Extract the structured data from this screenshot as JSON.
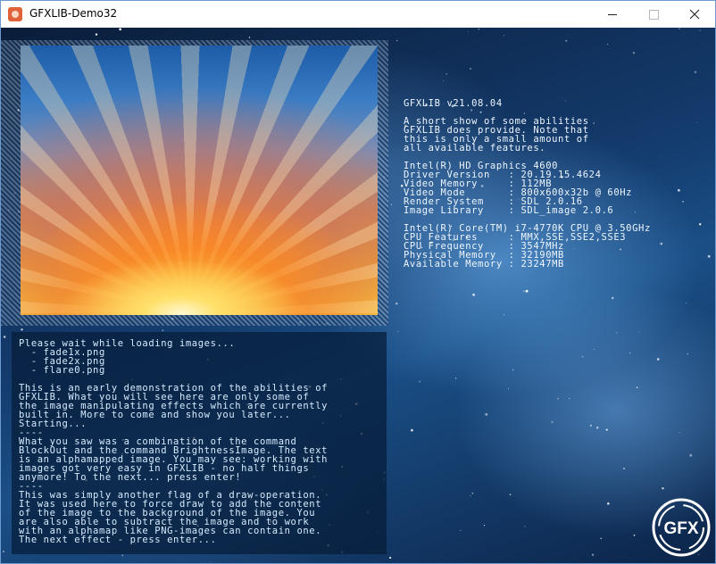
{
  "window": {
    "title": "GFXLIB-Demo32",
    "controls": {
      "minimize": "minimize",
      "maximize": "maximize",
      "close": "close"
    }
  },
  "system_info": {
    "lines": [
      "GFXLIB v21.08.04",
      "",
      "A short show of some abilities",
      "GFXLIB does provide. Note that",
      "this is only a small amount of",
      "all available features.",
      "",
      "Intel(R) HD Graphics 4600",
      "Driver Version   : 20.19.15.4624",
      "Video Memory     : 112MB",
      "Video Mode       : 800x600x32b @ 60Hz",
      "Render System    : SDL 2.0.16",
      "Image Library    : SDL_image 2.0.6",
      "",
      "Intel(R) Core(TM) i7-4770K CPU @ 3.50GHz",
      "CPU Features     : MMX,SSE,SSE2,SSE3",
      "CPU Frequency    : 3547MHz",
      "Physical Memory  : 32190MB",
      "Available Memory : 23247MB"
    ]
  },
  "log": {
    "lines": [
      "Please wait while loading images...",
      "  - fade1x.png",
      "  - fade2x.png",
      "  - flare0.png",
      "",
      "This is an early demonstration of the abilities of",
      "GFXLIB. What you will see here are only some of",
      "the image manipulating effects which are currently",
      "built in. More to come and show you later...",
      "Starting...",
      "----",
      "What you saw was a combination of the command",
      "BlockOut and the command BrightnessImage. The text",
      "is an alphamapped image. You may see: working with",
      "images got very easy in GFXLIB - no half things",
      "anymore! To the next... press enter!",
      "----",
      "This was simply another flag of a draw-operation.",
      "It was used here to force draw to add the content",
      "of the image to the background of the image. You",
      "are also able to subtract the image and to work",
      "with an alphamap like PNG-images can contain one.",
      "The next effect - press enter..."
    ]
  },
  "logo": {
    "text": "GFX"
  },
  "colors": {
    "text": "#d6ecff",
    "background": "#143c6e"
  }
}
